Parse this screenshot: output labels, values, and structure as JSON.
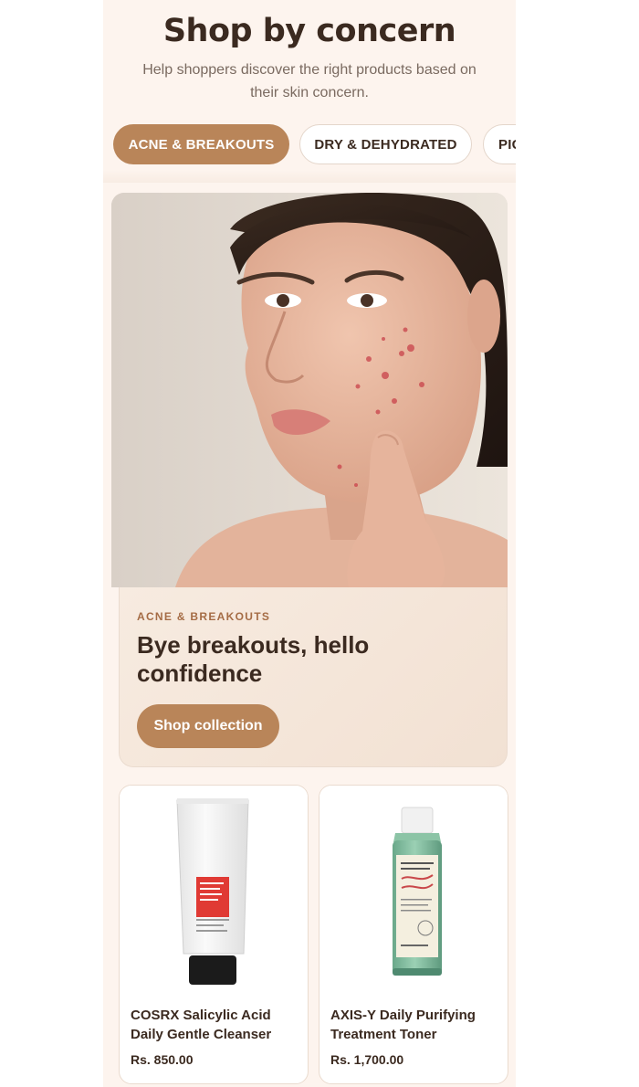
{
  "section": {
    "title": "Shop by concern",
    "subtitle": "Help shoppers discover the right products based on their skin concern."
  },
  "tabs": [
    {
      "label": "ACNE & BREAKOUTS",
      "active": true
    },
    {
      "label": "DRY & DEHYDRATED",
      "active": false
    },
    {
      "label": "PIGMENTATION",
      "active": false
    }
  ],
  "hero": {
    "image_icon": "woman-with-acne-photo",
    "eyebrow": "ACNE & BREAKOUTS",
    "headline": "Bye breakouts, hello confidence",
    "cta_label": "Shop collection"
  },
  "products": [
    {
      "name": "COSRX Salicylic Acid Daily Gentle Cleanser",
      "price": "Rs. 850.00",
      "image_icon": "cleanser-tube-photo"
    },
    {
      "name": "AXIS-Y Daily Purifying Treatment Toner",
      "price": "Rs. 1,700.00",
      "image_icon": "toner-bottle-photo"
    }
  ],
  "colors": {
    "accent": "#b98559",
    "text_dark": "#3b2a20",
    "background": "#fdf4ee"
  }
}
